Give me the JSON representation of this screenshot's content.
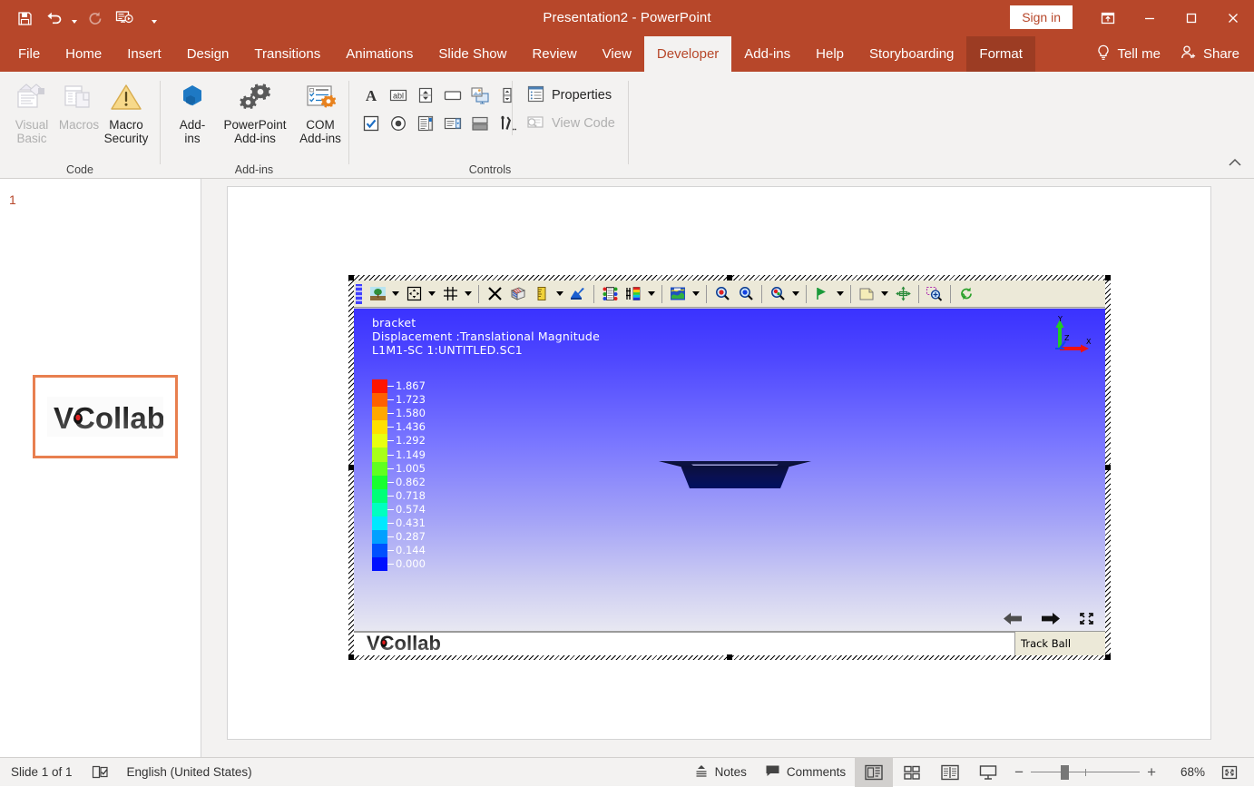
{
  "titlebar": {
    "title": "Presentation2  -  PowerPoint",
    "signin_label": "Sign in",
    "quick_access": [
      {
        "name": "save-icon",
        "label": "Save"
      },
      {
        "name": "undo-icon",
        "label": "Undo"
      },
      {
        "name": "redo-icon",
        "label": "Redo"
      },
      {
        "name": "start-from-beginning-icon",
        "label": "Start From Beginning"
      },
      {
        "name": "customize-quick-access-toolbar-icon",
        "label": "Customize Quick Access Toolbar"
      }
    ],
    "window_buttons": [
      {
        "name": "ribbon-display-options-icon",
        "label": "Ribbon Display Options"
      },
      {
        "name": "minimize-icon",
        "label": "Minimize"
      },
      {
        "name": "restore-icon",
        "label": "Restore Down"
      },
      {
        "name": "close-icon",
        "label": "Close"
      }
    ]
  },
  "ribbon": {
    "tabs": [
      {
        "label": "File",
        "state": "normal"
      },
      {
        "label": "Home",
        "state": "normal"
      },
      {
        "label": "Insert",
        "state": "normal"
      },
      {
        "label": "Design",
        "state": "normal"
      },
      {
        "label": "Transitions",
        "state": "normal"
      },
      {
        "label": "Animations",
        "state": "normal"
      },
      {
        "label": "Slide Show",
        "state": "normal"
      },
      {
        "label": "Review",
        "state": "normal"
      },
      {
        "label": "View",
        "state": "normal"
      },
      {
        "label": "Developer",
        "state": "active"
      },
      {
        "label": "Add-ins",
        "state": "normal"
      },
      {
        "label": "Help",
        "state": "normal"
      },
      {
        "label": "Storyboarding",
        "state": "normal"
      },
      {
        "label": "Format",
        "state": "contextual"
      }
    ],
    "tell_me": "Tell me",
    "share": "Share",
    "groups": {
      "code": {
        "label": "Code",
        "buttons": [
          {
            "line1": "Visual",
            "line2": "Basic",
            "enabled": false,
            "icon": "visual-basic-icon"
          },
          {
            "line1": "Macros",
            "line2": "",
            "enabled": false,
            "icon": "macros-icon"
          },
          {
            "line1": "Macro",
            "line2": "Security",
            "enabled": true,
            "icon": "macro-security-icon"
          }
        ]
      },
      "addins": {
        "label": "Add-ins",
        "buttons": [
          {
            "line1": "Add-",
            "line2": "ins",
            "enabled": true,
            "icon": "add-ins-icon"
          },
          {
            "line1": "PowerPoint",
            "line2": "Add-ins",
            "enabled": true,
            "icon": "powerpoint-add-ins-icon"
          },
          {
            "line1": "COM",
            "line2": "Add-ins",
            "enabled": true,
            "icon": "com-add-ins-icon"
          }
        ]
      },
      "controls": {
        "label": "Controls",
        "row1": [
          {
            "name": "label-control-icon"
          },
          {
            "name": "text-box-control-icon"
          },
          {
            "name": "spin-button-control-icon"
          },
          {
            "name": "command-button-control-icon"
          },
          {
            "name": "image-control-icon"
          },
          {
            "name": "scroll-bar-control-icon"
          }
        ],
        "row2": [
          {
            "name": "check-box-control-icon"
          },
          {
            "name": "option-button-control-icon"
          },
          {
            "name": "list-box-control-icon"
          },
          {
            "name": "combo-box-control-icon"
          },
          {
            "name": "toggle-button-control-icon"
          },
          {
            "name": "more-controls-icon"
          }
        ],
        "properties_label": "Properties",
        "view_code_label": "View Code",
        "view_code_enabled": false
      }
    }
  },
  "thumbnails": {
    "slides": [
      {
        "number": "1",
        "selected": true,
        "content": "VCollab"
      }
    ]
  },
  "viewer": {
    "toolbar_left": [
      {
        "name": "scene-background-icon",
        "caret": true
      },
      {
        "name": "fit-view-icon",
        "caret": true
      },
      {
        "name": "grid-icon",
        "caret": true
      },
      {
        "name": "free-rotate-icon",
        "caret": false
      },
      {
        "name": "clip-plane-icon",
        "caret": false
      },
      {
        "name": "measure-icon",
        "caret": true
      },
      {
        "name": "probe-icon",
        "caret": false
      },
      {
        "name": "color-map-icon",
        "caret": false
      },
      {
        "name": "legend-icon",
        "caret": true
      },
      {
        "name": "contour-plot-icon",
        "caret": true
      },
      {
        "name": "zoom-in-icon",
        "caret": false
      },
      {
        "name": "zoom-out-icon",
        "caret": false
      },
      {
        "name": "zoom-fit-icon",
        "caret": true
      },
      {
        "name": "animate-play-icon",
        "caret": true
      },
      {
        "name": "report-page-icon",
        "caret": true
      },
      {
        "name": "pan-move-icon",
        "caret": false
      },
      {
        "name": "zoom-window-icon",
        "caret": false
      },
      {
        "name": "reset-view-icon",
        "caret": false
      }
    ],
    "overlay": {
      "line1": "bracket",
      "line2": "Displacement :Translational Magnitude",
      "line3": "L1M1-SC 1:UNTITLED.SC1"
    },
    "triad": {
      "x": "X",
      "y": "Y",
      "z": "Z"
    },
    "nav_buttons": [
      {
        "name": "previous-state-icon"
      },
      {
        "name": "next-state-icon"
      },
      {
        "name": "full-screen-icon"
      }
    ],
    "status_text": "Track Ball",
    "logo_text": "VCollab",
    "chart_data": {
      "type": "heatmap",
      "title": "bracket",
      "subtitle": "Displacement :Translational Magnitude",
      "dataset": "L1M1-SC 1:UNTITLED.SC1",
      "legend_title": "Displacement :Translational Magnitude",
      "legend_position": "left",
      "ylim": [
        0.0,
        1.867
      ],
      "values": [
        1.867,
        1.723,
        1.58,
        1.436,
        1.292,
        1.149,
        1.005,
        0.862,
        0.718,
        0.574,
        0.431,
        0.287,
        0.144,
        0.0
      ],
      "tick_labels": [
        "1.867",
        "1.723",
        "1.580",
        "1.436",
        "1.292",
        "1.149",
        "1.005",
        "0.862",
        "0.718",
        "0.574",
        "0.431",
        "0.287",
        "0.144",
        "0.000"
      ],
      "colors": [
        "#ff1500",
        "#ff6000",
        "#ffa800",
        "#ffe000",
        "#e8ff10",
        "#a8ff18",
        "#60ff20",
        "#18ff30",
        "#00ff78",
        "#00ffc0",
        "#00e8ff",
        "#00a0ff",
        "#0050ff",
        "#0010ff"
      ],
      "colormap": "rainbow",
      "xlabel": "",
      "ylabel": ""
    }
  },
  "statusbar": {
    "slide_count": "Slide 1 of 1",
    "spellcheck_icon": "spell-check-icon",
    "language": "English (United States)",
    "notes_label": "Notes",
    "comments_label": "Comments",
    "views": [
      {
        "name": "normal-view-button",
        "label": "Normal",
        "active": true
      },
      {
        "name": "slide-sorter-view-button",
        "label": "Slide Sorter",
        "active": false
      },
      {
        "name": "reading-view-button",
        "label": "Reading View",
        "active": false
      },
      {
        "name": "slide-show-button",
        "label": "Slide Show",
        "active": false
      }
    ],
    "zoom_out_label": "−",
    "zoom_in_label": "+",
    "zoom_level": "68%",
    "fit_label": "Fit slide to current window"
  }
}
